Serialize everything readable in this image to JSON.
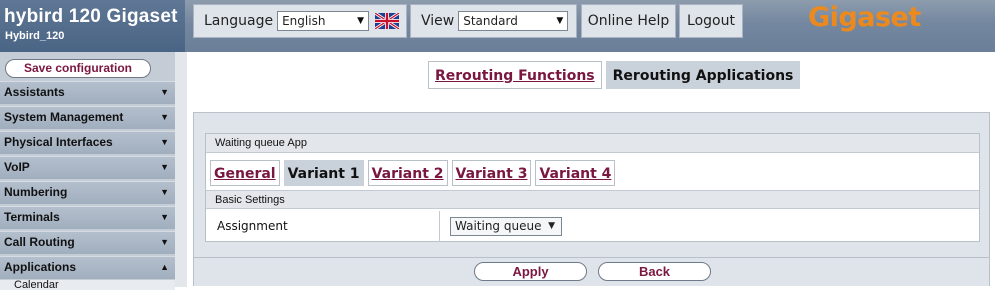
{
  "brand": {
    "title": "hybird 120 Gigaset",
    "subtitle": "Hybird_120"
  },
  "header": {
    "language_label": "Language",
    "language_value": "English",
    "view_label": "View",
    "view_value": "Standard",
    "online_help": "Online Help",
    "logout": "Logout",
    "logo": "Gigaset"
  },
  "sidebar": {
    "save_label": "Save configuration",
    "items": [
      {
        "label": "Assistants"
      },
      {
        "label": "System Management"
      },
      {
        "label": "Physical Interfaces"
      },
      {
        "label": "VoIP"
      },
      {
        "label": "Numbering"
      },
      {
        "label": "Terminals"
      },
      {
        "label": "Call Routing"
      },
      {
        "label": "Applications"
      }
    ],
    "sub_item": "Calendar"
  },
  "top_tabs": {
    "first": "Rerouting Functions",
    "second": "Rerouting Applications"
  },
  "panel": {
    "section_title": "Waiting queue App",
    "subtabs": [
      "General",
      "Variant 1",
      "Variant 2",
      "Variant 3",
      "Variant 4"
    ],
    "basic_settings": "Basic Settings",
    "assignment_label": "Assignment",
    "assignment_value": "Waiting queue"
  },
  "buttons": {
    "apply": "Apply",
    "back": "Back"
  },
  "colors": {
    "link": "#7a1740",
    "logo": "#f28a17",
    "header": "#7487a0"
  }
}
